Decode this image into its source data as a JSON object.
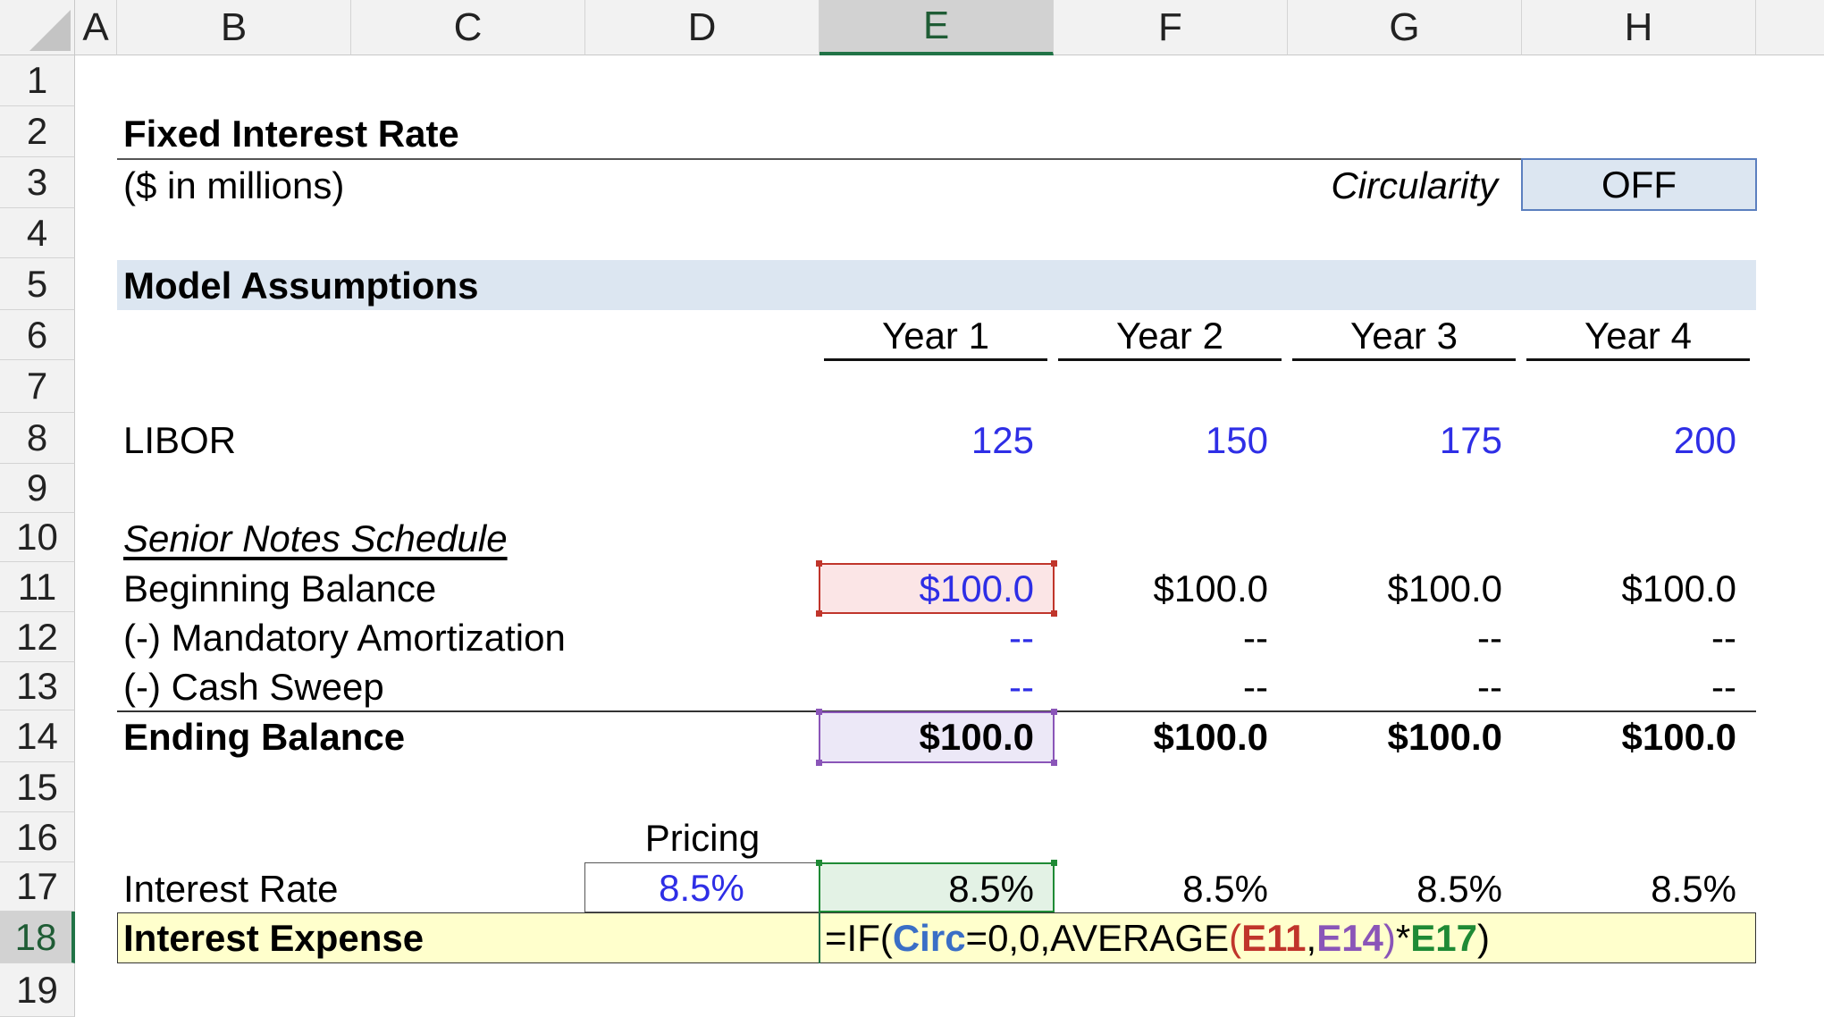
{
  "columns": [
    "A",
    "B",
    "C",
    "D",
    "E",
    "F",
    "G",
    "H"
  ],
  "selected_column": "E",
  "rows": [
    "1",
    "2",
    "3",
    "4",
    "5",
    "6",
    "7",
    "8",
    "9",
    "10",
    "11",
    "12",
    "13",
    "14",
    "15",
    "16",
    "17",
    "18",
    "19"
  ],
  "selected_row": "18",
  "title": "Fixed Interest Rate",
  "units": "($ in millions)",
  "circularity": {
    "label": "Circularity",
    "value": "OFF"
  },
  "section_header": "Model Assumptions",
  "years": [
    "Year 1",
    "Year 2",
    "Year 3",
    "Year 4"
  ],
  "libor": {
    "label": "LIBOR",
    "values": [
      "125",
      "150",
      "175",
      "200"
    ]
  },
  "schedule_title": "Senior Notes Schedule",
  "beginning_balance": {
    "label": "Beginning Balance",
    "values": [
      "$100.0",
      "$100.0",
      "$100.0",
      "$100.0"
    ]
  },
  "mandatory_amortization": {
    "label": "(-) Mandatory Amortization",
    "values": [
      "--",
      "--",
      "--",
      "--"
    ]
  },
  "cash_sweep": {
    "label": "(-) Cash Sweep",
    "values": [
      "--",
      "--",
      "--",
      "--"
    ]
  },
  "ending_balance": {
    "label": "Ending Balance",
    "values": [
      "$100.0",
      "$100.0",
      "$100.0",
      "$100.0"
    ]
  },
  "pricing": {
    "label": "Pricing",
    "value": "8.5%"
  },
  "interest_rate": {
    "label": "Interest Rate",
    "values": [
      "8.5%",
      "8.5%",
      "8.5%",
      "8.5%"
    ]
  },
  "interest_expense": {
    "label": "Interest Expense",
    "formula": {
      "p1": "=IF(",
      "ref_circ": "Circ",
      "p2": "=0,0,AVERAGE",
      "open": "(",
      "ref_e11": "E11",
      "comma": ",",
      "ref_e14": "E14",
      "close": ")",
      "mult": "*",
      "ref_e17": "E17",
      "end": ")"
    }
  },
  "colors": {
    "header_bg": "#f2f2f2",
    "selected_header_bg": "#d2d2d2",
    "accent_green": "#217346",
    "input_blue": "#2e2ee6",
    "section_band": "#dce6f1",
    "circularity_box": "#dce6f1",
    "interest_expense_band": "#ffffcc",
    "ref_e11": "#c0352b",
    "ref_e14": "#8a55b8",
    "ref_e17": "#1f8a35",
    "ref_circ": "#3a6ec6"
  }
}
